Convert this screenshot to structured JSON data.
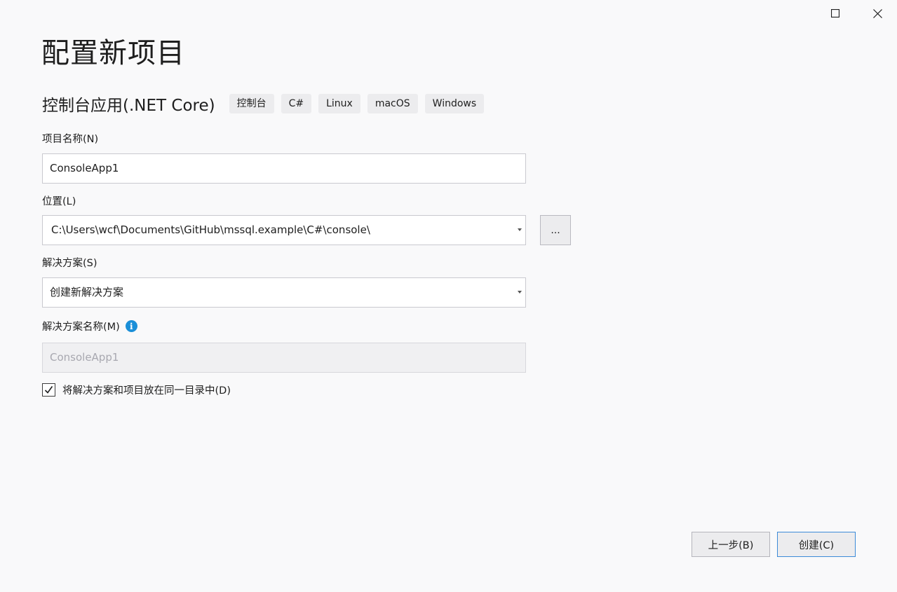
{
  "window": {
    "maximize_icon": "maximize-icon",
    "close_icon": "close-icon"
  },
  "page": {
    "title": "配置新项目"
  },
  "template": {
    "name": "控制台应用(.NET Core)",
    "tags": [
      "控制台",
      "C#",
      "Linux",
      "macOS",
      "Windows"
    ]
  },
  "project_name": {
    "label": "项目名称(N)",
    "value": "ConsoleApp1"
  },
  "location": {
    "label": "位置(L)",
    "value": "C:\\Users\\wcf\\Documents\\GitHub\\mssql.example\\C#\\console\\",
    "browse_label": "..."
  },
  "solution": {
    "label": "解决方案(S)",
    "value": "创建新解决方案"
  },
  "solution_name": {
    "label": "解决方案名称(M)",
    "value": "ConsoleApp1",
    "info_icon": "info-icon",
    "enabled": false
  },
  "same_dir": {
    "label": "将解决方案和项目放在同一目录中(D)",
    "checked": true
  },
  "footer": {
    "back_label": "上一步(B)",
    "create_label": "创建(C)"
  },
  "colors": {
    "background": "#f9f9fa",
    "tag_background": "#ececee",
    "info_icon": "#1b8fd8",
    "primary_border": "#3c8ad8"
  }
}
